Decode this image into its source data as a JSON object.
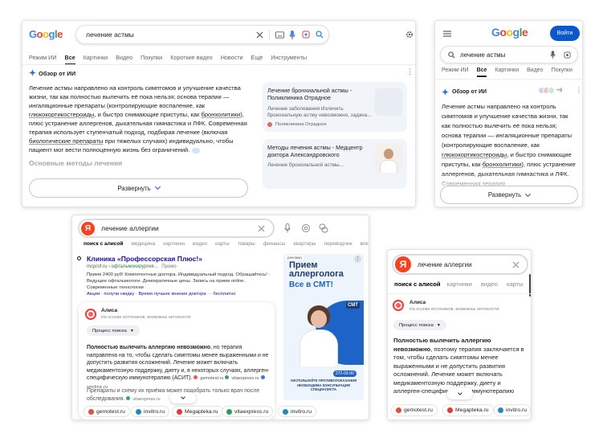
{
  "google_desktop": {
    "logo": "Google",
    "query": "лечение астмы",
    "tabs": [
      "Режим ИИ",
      "Все",
      "Картинки",
      "Видео",
      "Покупки",
      "Короткие видео",
      "Новости",
      "Ещё",
      "Инструменты"
    ],
    "ai_title": "Обзор от ИИ",
    "para_1": "Лечение астмы направлено на контроль симптомов и улучшение качества жизни, так как полностью вылечить её пока нельзя; основа терапии — ингаляционные препараты (контролирующие воспаление, как",
    "link_1": "глюкокортикостероиды",
    "para_2": ", и быстро снимающие приступы, как",
    "link_2": "бронхолитики",
    "para_3": "), плюс устранение аллергенов, дыхательная гимнастика и ЛФК. Современная терапия использует ступенчатый подход, подбирая лечение (включая",
    "link_3": "биологические препараты",
    "para_4": "при тяжелых случаях) индивидуально, чтобы пациент мог вести полноценную жизнь без ограничений.",
    "faded_heading": "Основные методы лечения",
    "expand_label": "Развернуть",
    "source_1_title": "Лечение бронхиальной астмы - Поликлиника Отрадное",
    "source_1_desc": "Лечение заболевания Излечить бронхиальную астму невозможно, задача...",
    "source_1_site": "Поликлиника Отрадное",
    "source_2_title": "Методы лечения астмы - Медцентр доктора Александровского",
    "source_2_desc": "Лечение бронхиальной астмы..."
  },
  "google_mobile": {
    "logo": "Google",
    "signin": "Войти",
    "query": "лечение астмы",
    "tabs": [
      "Режим ИИ",
      "Все",
      "Картинки",
      "Видео",
      "Покупки"
    ],
    "ai_title": "Обзор от ИИ",
    "extra_count": "+8",
    "para_1": "Лечение астмы направлено на контроль симптомов и улучшение качества жизни, так как полностью вылечить её пока нельзя; основа терапии — ингаляционные препараты (контролирующие воспаление, как",
    "link_1": "глюкокортикостероиды",
    "para_2": ", и быстро снимающие приступы, как",
    "link_2": "бронхолитики",
    "para_3": "), плюс устранение аллергенов, дыхательная гимнастика и ЛФК. Современная терапия",
    "expand_label": "Развернуть"
  },
  "yandex_desktop": {
    "logo": "Я",
    "query": "лечение аллергии",
    "tabs": [
      "поиск с алисой",
      "медицина",
      "картинки",
      "видео",
      "карты",
      "товары",
      "финансы",
      "квартиры",
      "переводчик",
      "все"
    ],
    "ad_title": "Клиника «Профессорская Плюс!»",
    "ad_url": "mcprof.ru › офтальмохирургия...",
    "ad_label": "Промо",
    "ad_desc": "Прием 2400 руб! Компетентные доктора. Индивидуальный подход. Обращайтесь! · Ведущие офтальмологи. Демократичные цены. Запись на прием online. Современные технологии",
    "ad_links": "Акции · получи скидку · Время лучшее мнение доктора · · бесплатно",
    "alisa_name": "Алиса",
    "alisa_sub": "На основе источников, возможны неточности",
    "process_label": "Процесс поиска",
    "answer_bold": "Полностью вылечить аллергию невозможно",
    "answer_1": ", но терапия направлена на то, чтобы сделать симптомы менее выраженными и не допустить развития осложнений. Лечение может включать медикаментозную поддержку, диету и, в некоторых случаях, аллерген-специфическую иммунотерапию (АСИТ).",
    "cite_1": "gemotest.ru",
    "cite_2": "vitaexpress.ru",
    "cite_3": "smclinic.ru",
    "answer_2": "Препараты и схему их приёма может подобрать только врач после обследования.",
    "cite_4": "vitaexpress.ru",
    "chips": [
      "gemotest.ru",
      "invitro.ru",
      "Megapteka.ru",
      "vitaexpress.ru",
      "invitro.ru"
    ],
    "banner_tag": "реклама",
    "banner_title_1": "Прием",
    "banner_title_2": "аллерголога",
    "banner_title_3": "Все в СМТ!",
    "banner_logo": "СМТ",
    "banner_phone": "272-03-00",
    "banner_footer_1": "#ИСПОЛЬЗУЙТЕ ПРОТИВОПОКАЗАНИЯ",
    "banner_footer_2": "НЕОБХОДИМА КОНСУЛЬТАЦИЯ СПЕЦИАЛИСТА"
  },
  "yandex_mobile": {
    "logo": "Я",
    "query": "лечение аллергии",
    "tabs": [
      "поиск с алисой",
      "картинки",
      "видео",
      "карты"
    ],
    "alisa_name": "Алиса",
    "alisa_sub": "На основе источников, возможны неточности",
    "process_label": "Процесс поиска",
    "answer_bold": "Полностью вылечить аллергию невозможно",
    "answer_1": ", поэтому терапия заключается в том, чтобы сделать симптомы менее выраженными и не допустить развития осложнений. Лечение может включать медикаментозную поддержку, диету и аллерген-специфическую иммунотерапию",
    "chips": [
      "gemotest.ru",
      "Megapteka.ru",
      "invitro.ru"
    ]
  },
  "colors": {
    "google_blue": "#0b57d0",
    "yandex_red": "#fc3f1d",
    "banner_blue": "#1e64c8"
  }
}
